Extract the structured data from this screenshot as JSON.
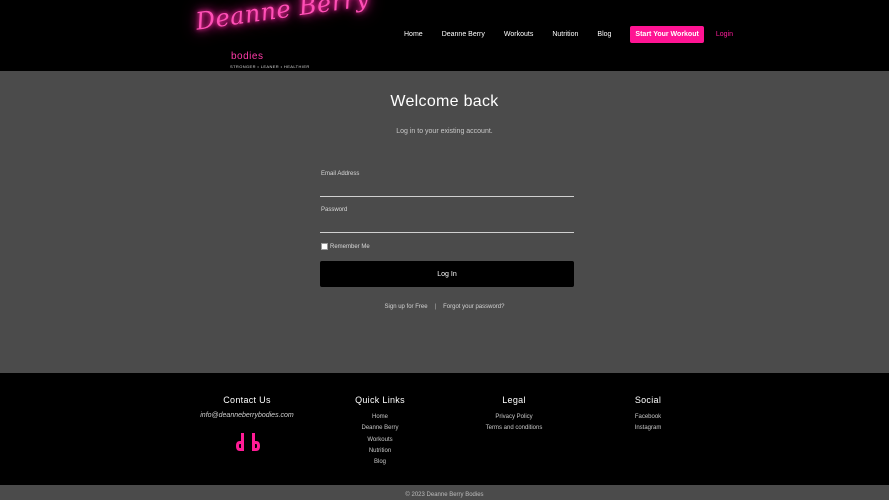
{
  "header": {
    "logo": {
      "script": "Deanne Berry",
      "sub": "bodies",
      "tagline": "STRONGER • LEANER • HEALTHIER"
    },
    "nav": {
      "items": [
        "Home",
        "Deanne Berry",
        "Workouts",
        "Nutrition",
        "Blog"
      ],
      "cta": "Start Your Workout",
      "login": "Login"
    }
  },
  "login": {
    "title": "Welcome back",
    "subtitle": "Log in to your existing account.",
    "email_label": "Email Address",
    "email_value": "",
    "password_label": "Password",
    "password_value": "",
    "remember_label": "Remember Me",
    "remember_checked": false,
    "button_label": "Log In",
    "signup_link": "Sign up for Free",
    "separator": "|",
    "forgot_link": "Forgot your password?"
  },
  "footer": {
    "contact": {
      "heading": "Contact Us",
      "email": "info@deanneberrybodies.com",
      "icon": "db-monogram-icon"
    },
    "quick_links": {
      "heading": "Quick Links",
      "items": [
        "Home",
        "Deanne Berry",
        "Workouts",
        "Nutrition",
        "Blog"
      ]
    },
    "legal": {
      "heading": "Legal",
      "items": [
        "Privacy Policy",
        "Terms and conditions"
      ]
    },
    "social": {
      "heading": "Social",
      "items": [
        "Facebook",
        "Instagram"
      ]
    },
    "copyright": "© 2023 Deanne Berry Bodies"
  },
  "colors": {
    "accent": "#ff1493",
    "background": "#4b4b4b",
    "header_footer": "#000000"
  }
}
